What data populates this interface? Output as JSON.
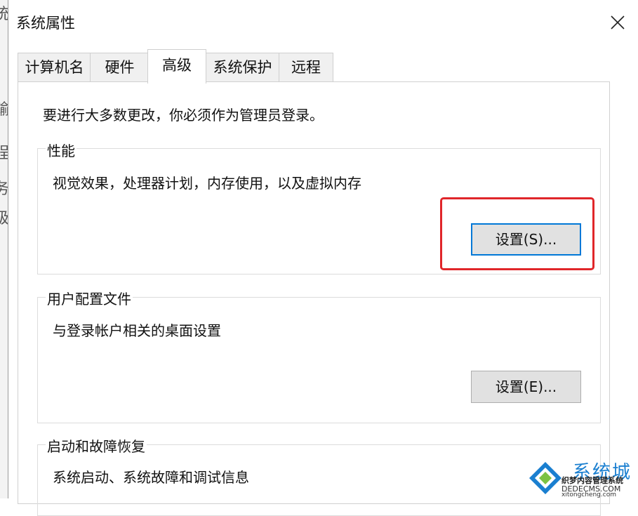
{
  "background_window": {
    "glyphs": [
      "统",
      "輸",
      "程",
      "务",
      "级"
    ]
  },
  "window": {
    "title": "系统属性",
    "close_icon": "close-icon"
  },
  "tabs": [
    {
      "label": "计算机名",
      "active": false
    },
    {
      "label": "硬件",
      "active": false
    },
    {
      "label": "高级",
      "active": true
    },
    {
      "label": "系统保护",
      "active": false
    },
    {
      "label": "远程",
      "active": false
    }
  ],
  "advanced": {
    "admin_note": "要进行大多数更改，你必须作为管理员登录。",
    "performance": {
      "title": "性能",
      "description": "视觉效果，处理器计划，内存使用，以及虚拟内存",
      "button": "设置(S)..."
    },
    "user_profiles": {
      "title": "用户配置文件",
      "description": "与登录帐户相关的桌面设置",
      "button": "设置(E)..."
    },
    "startup_recovery": {
      "title": "启动和故障恢复",
      "description": "系统启动、系统故障和调试信息"
    }
  },
  "annotation": {
    "color": "#e0262a"
  },
  "watermark": {
    "brand": "系统城",
    "line1": "织梦内容管理系统",
    "line2": "DEDECMS.COM",
    "line3": "xitongcheng.com"
  },
  "colors": {
    "focus_border": "#0078d7",
    "button_bg": "#e1e1e1",
    "tab_bg": "#f0f0f0"
  }
}
